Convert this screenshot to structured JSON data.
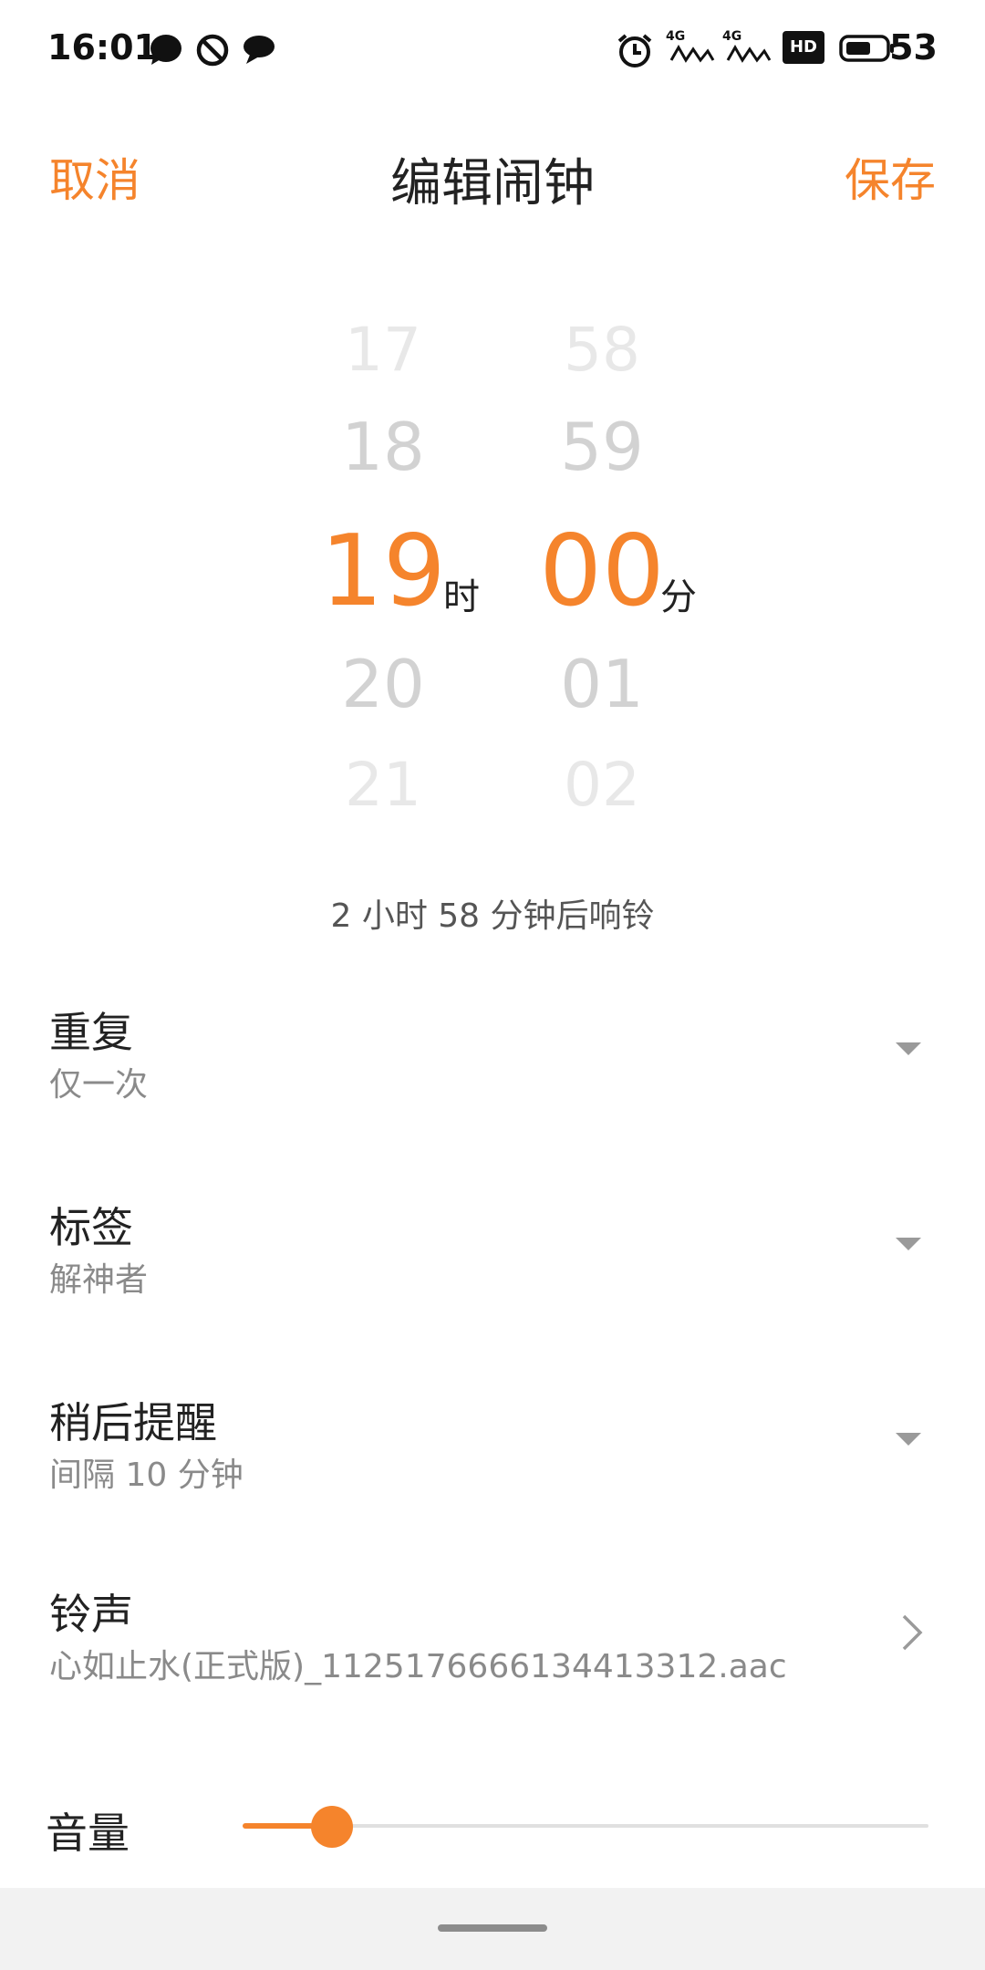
{
  "status_bar": {
    "time": "16:01",
    "battery_percent": "53",
    "network_labels": [
      "4G",
      "4G"
    ],
    "hd_label": "HD",
    "icons": [
      "chat-bubble-icon",
      "do-not-disturb-icon",
      "message-icon",
      "alarm-icon",
      "signal-4g-icon",
      "signal-4g-icon",
      "hd-icon",
      "battery-icon"
    ]
  },
  "header": {
    "cancel_label": "取消",
    "title": "编辑闹钟",
    "save_label": "保存"
  },
  "time_picker": {
    "hours": [
      "17",
      "18",
      "19",
      "20",
      "21"
    ],
    "minutes": [
      "58",
      "59",
      "00",
      "01",
      "02"
    ],
    "selected_hour": "19",
    "selected_minute": "00",
    "hour_unit": "时",
    "minute_unit": "分"
  },
  "countdown_text": "2 小时 58 分钟后响铃",
  "settings": [
    {
      "title": "重复",
      "value": "仅一次",
      "control": "dropdown-icon"
    },
    {
      "title": "标签",
      "value": "解神者",
      "control": "dropdown-icon"
    },
    {
      "title": "稍后提醒",
      "value": "间隔 10 分钟",
      "control": "dropdown-icon"
    },
    {
      "title": "铃声",
      "value": "心如止水(正式版)_1125176666134413312.aac",
      "control": "chevron-right-icon"
    }
  ],
  "volume": {
    "label": "音量",
    "level": 0.13
  },
  "colors": {
    "accent": "#F5842C",
    "text_primary": "#222222",
    "text_secondary": "#8A8A8A"
  }
}
